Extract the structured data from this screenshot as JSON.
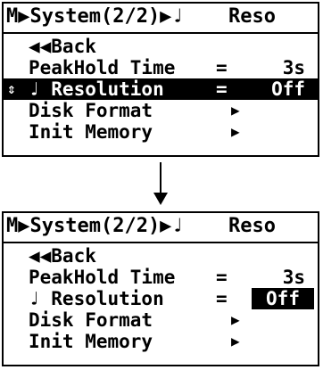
{
  "screens": [
    {
      "header_left": "M▶System(2/2)▶♩",
      "header_right": "Reso",
      "items": [
        {
          "label": "◀◀Back",
          "eq": "",
          "value": ""
        },
        {
          "label": "PeakHold Time",
          "eq": "=",
          "value": "3s"
        },
        {
          "label": "♩ Resolution",
          "eq": "=",
          "value": "Off"
        },
        {
          "label": "Disk Format",
          "eq": "",
          "value": "▶"
        },
        {
          "label": "Init Memory",
          "eq": "",
          "value": "▶"
        }
      ],
      "cursor": "⇕"
    },
    {
      "header_left": "M▶System(2/2)▶♩",
      "header_right": "Reso",
      "items": [
        {
          "label": "◀◀Back",
          "eq": "",
          "value": ""
        },
        {
          "label": "PeakHold Time",
          "eq": "=",
          "value": "3s"
        },
        {
          "label": "♩ Resolution",
          "eq": "=",
          "value": "Off"
        },
        {
          "label": "Disk Format",
          "eq": "",
          "value": "▶"
        },
        {
          "label": "Init Memory",
          "eq": "",
          "value": "▶"
        }
      ]
    }
  ],
  "colors": {
    "background": "#ffffff",
    "foreground": "#000000"
  }
}
